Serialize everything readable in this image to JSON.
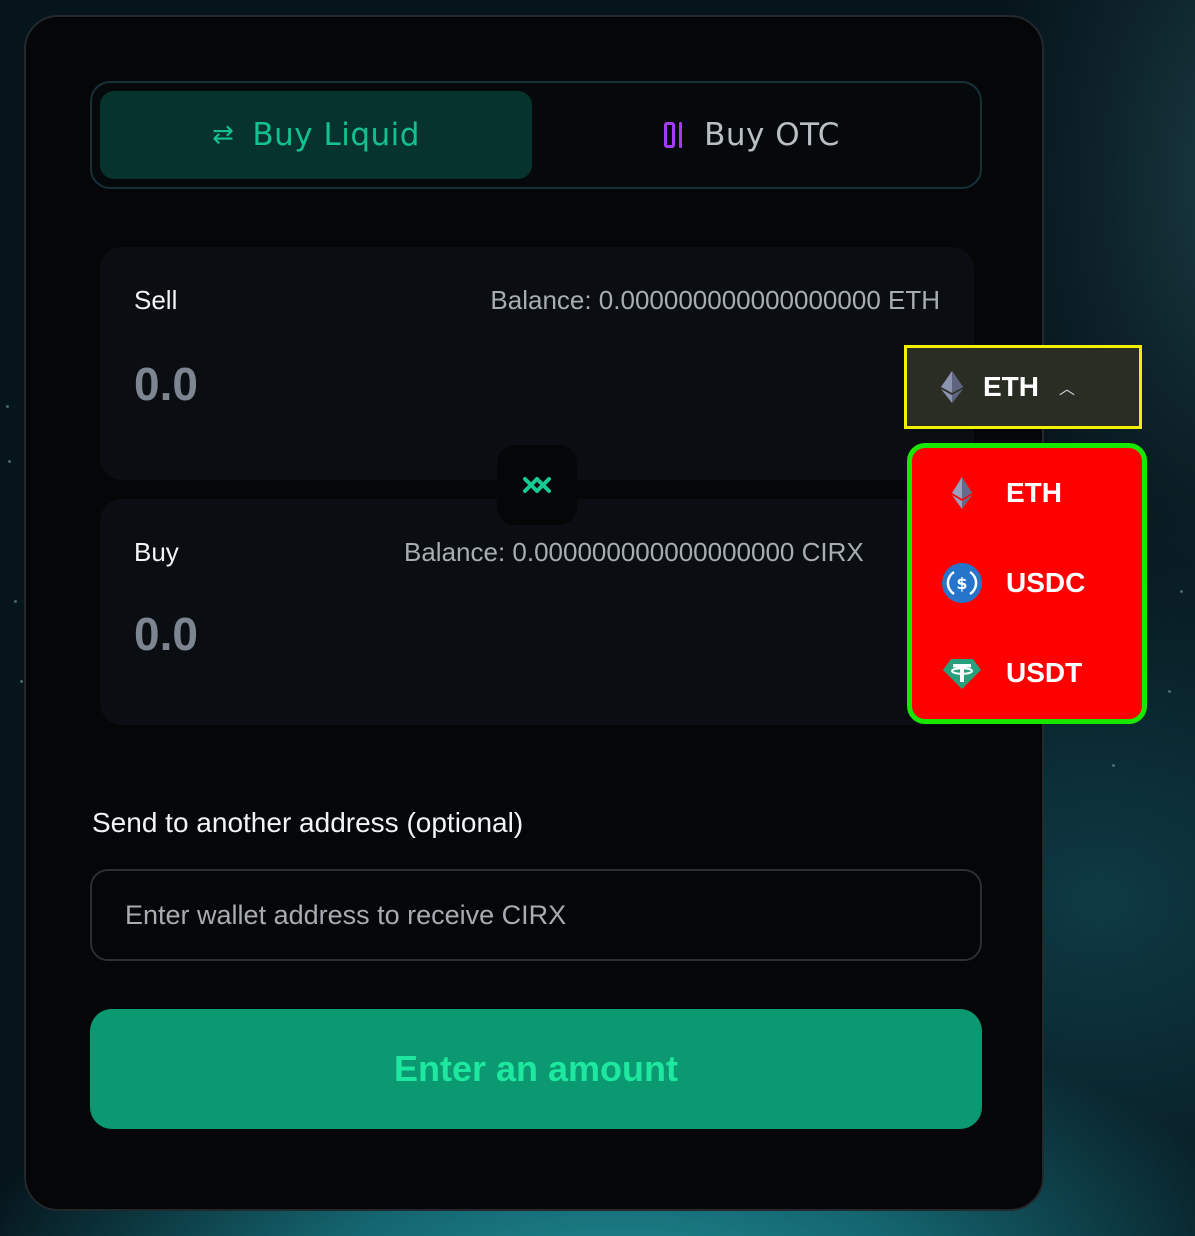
{
  "tabs": {
    "liquid_label": "Buy Liquid",
    "otc_label": "Buy OTC"
  },
  "sell": {
    "label": "Sell",
    "balance": "Balance: 0.000000000000000000 ETH",
    "amount": "0.0"
  },
  "buy": {
    "label": "Buy",
    "balance": "Balance: 0.000000000000000000 CIRX",
    "amount": "0.0"
  },
  "token_select": {
    "selected": "ETH",
    "icon": "ethereum-icon"
  },
  "token_dropdown": {
    "items": [
      {
        "symbol": "ETH",
        "icon": "ethereum-icon"
      },
      {
        "symbol": "USDC",
        "icon": "usdc-icon"
      },
      {
        "symbol": "USDT",
        "icon": "tether-icon"
      }
    ]
  },
  "recipient": {
    "label": "Send to another address (optional)",
    "placeholder": "Enter wallet address to receive CIRX",
    "value": ""
  },
  "cta": {
    "label": "Enter an amount"
  },
  "colors": {
    "accent": "#13c08e",
    "cta_bg": "#0a9970",
    "otc_icon": "#a13cff",
    "highlight_selector": "#f0f000",
    "highlight_dropdown_border": "#18e800",
    "highlight_dropdown_bg": "#ff0000"
  }
}
